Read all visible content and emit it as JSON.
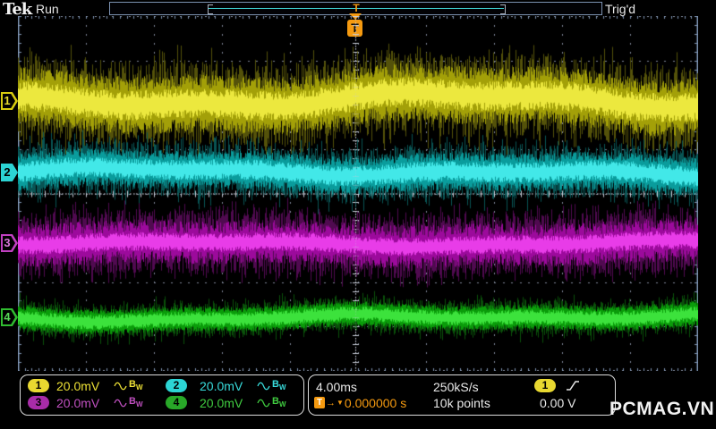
{
  "header": {
    "logo": "Tek",
    "acq_status": "Run",
    "trig_status": "Trig'd"
  },
  "record_view": {
    "trigger_label": "T"
  },
  "trigger_marker": {
    "label": "T"
  },
  "channels": [
    {
      "label": "1",
      "scale": "20.0mV",
      "bw_main": "B",
      "bw_sub": "W",
      "color": "#ece035",
      "badge_bg": "#e8d830",
      "marker_style": "outline",
      "marker_color": "#d8cc10",
      "num_color": "#e8dc30",
      "wave": {
        "baseline": 95,
        "core": 16,
        "band": 46,
        "spike": 67,
        "spike_p": 0.42,
        "wander": 10,
        "seed": 11,
        "bright": "#ece83e",
        "mid": "#a3a008",
        "dim": "#54520a"
      }
    },
    {
      "label": "2",
      "scale": "20.0mV",
      "bw_main": "B",
      "bw_sub": "W",
      "color": "#38dcdc",
      "badge_bg": "#2cd4d4",
      "marker_style": "solid",
      "marker_color": "#2cd4d4",
      "num_color": "#000000",
      "wave": {
        "baseline": 175,
        "core": 11,
        "band": 30,
        "spike": 46,
        "spike_p": 0.4,
        "wander": 6,
        "seed": 22,
        "bright": "#42e8e8",
        "mid": "#0a9c9c",
        "dim": "#085454"
      }
    },
    {
      "label": "3",
      "scale": "20.0mV",
      "bw_main": "B",
      "bw_sub": "W",
      "color": "#c050c0",
      "badge_bg": "#a82ca8",
      "marker_style": "outline",
      "marker_color": "#c040c0",
      "num_color": "#d878d8",
      "wave": {
        "baseline": 254,
        "core": 10,
        "band": 36,
        "spike": 50,
        "spike_p": 0.6,
        "wander": 4,
        "seed": 33,
        "bright": "#e83ce8",
        "mid": "#9c0a9c",
        "dim": "#500a50"
      }
    },
    {
      "label": "4",
      "scale": "20.0mV",
      "bw_main": "B",
      "bw_sub": "W",
      "color": "#40cc40",
      "badge_bg": "#28a828",
      "marker_style": "outline",
      "marker_color": "#30bc30",
      "num_color": "#58d858",
      "wave": {
        "baseline": 337,
        "core": 8,
        "band": 19,
        "spike": 29,
        "spike_p": 0.45,
        "wander": 5,
        "seed": 44,
        "bright": "#3ce23c",
        "mid": "#0a9c0a",
        "dim": "#0a500a"
      }
    }
  ],
  "horizontal": {
    "time_scale": "4.00ms",
    "sample_rate": "250kS/s",
    "record_length": "10k points",
    "position_label": "T",
    "arrow_right": "→",
    "arrow_down": "▼",
    "position": "0.000000 s"
  },
  "trigger": {
    "source": "1",
    "level": "0.00 V"
  },
  "watermark": "PCMAG.VN",
  "ui_colors": {
    "frame": "#7d93b2",
    "orange": "#f59a10",
    "grid_dot": "#7e8798",
    "center_line": "#c9ced9"
  }
}
